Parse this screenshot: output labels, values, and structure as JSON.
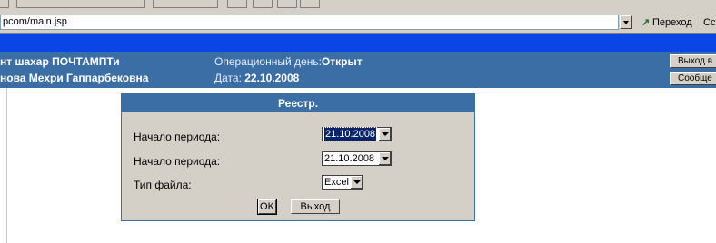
{
  "browser": {
    "address": "pcom/main.jsp",
    "go_label": "Переход",
    "links_label": "Ссылки"
  },
  "header": {
    "org_name": "нт шахар ПОЧТАМПТи",
    "user_name": "нова Мехри Гаппарбековна",
    "op_day_label": "Операционный день:",
    "op_day_value": "Открыт",
    "date_label": "Дата:",
    "date_value": "22.10.2008",
    "exit_button": "Выход в",
    "messages_button": "Сообще"
  },
  "dialog": {
    "title": "Реестр.",
    "fields": [
      {
        "label": "Начало периода:",
        "value": "21.10.2008",
        "selected": true
      },
      {
        "label": "Начало периода:",
        "value": "21.10.2008",
        "selected": false
      },
      {
        "label": "Тип файла:",
        "value": "Excel",
        "selected": false
      }
    ],
    "ok_label": "OK",
    "exit_label": "Выход"
  },
  "colors": {
    "blue_bar": "#0a46e6",
    "header_band": "#3b6ea5",
    "dialog_bg": "#d4d0c8"
  }
}
